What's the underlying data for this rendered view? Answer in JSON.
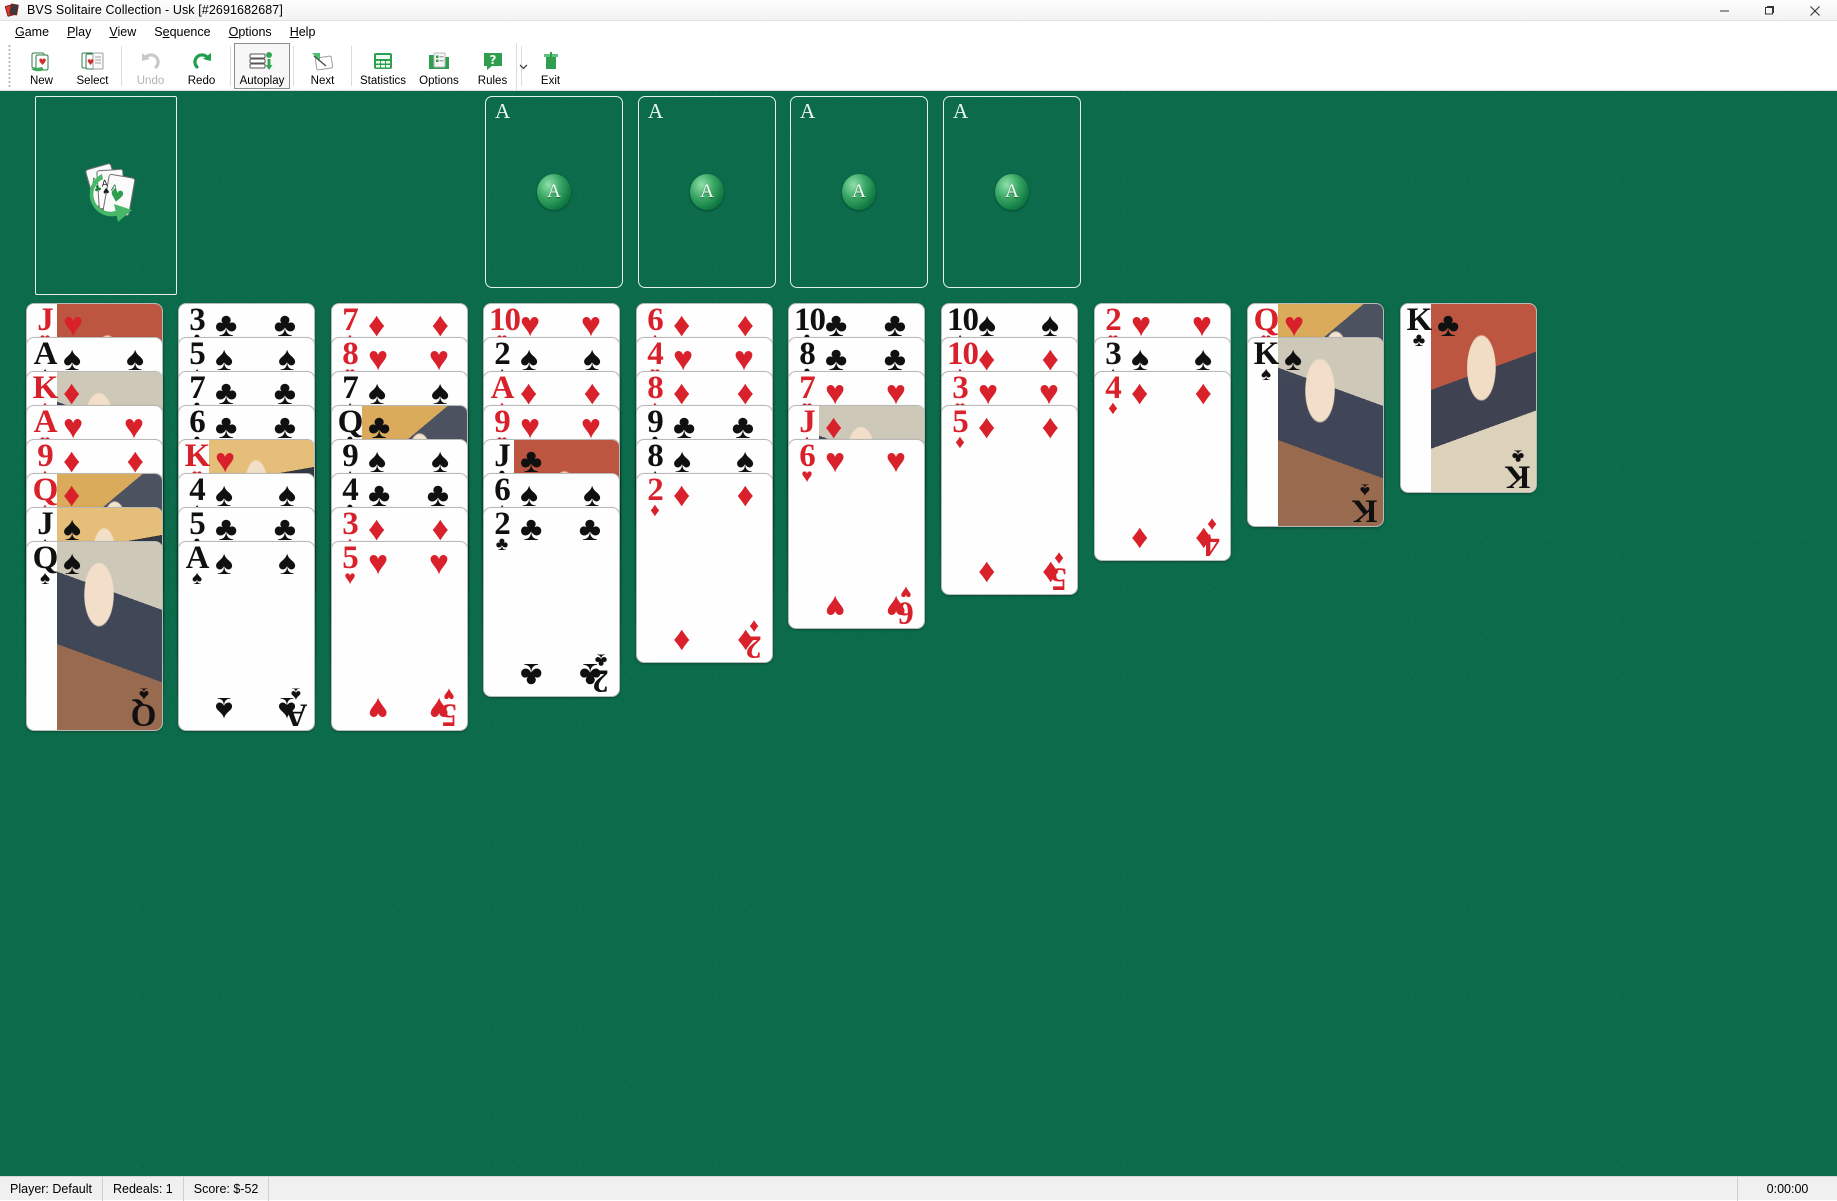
{
  "window": {
    "title": "BVS Solitaire Collection  -  Usk [#2691682687]",
    "icon": "cards-icon",
    "minimize": "minimize-icon",
    "maximize": "maximize-icon",
    "close": "close-icon"
  },
  "menu": {
    "items": [
      {
        "label": "Game",
        "accel": "G"
      },
      {
        "label": "Play",
        "accel": "P"
      },
      {
        "label": "View",
        "accel": "V"
      },
      {
        "label": "Sequence",
        "accel": "S"
      },
      {
        "label": "Options",
        "accel": "O"
      },
      {
        "label": "Help",
        "accel": "H"
      }
    ]
  },
  "toolbar": {
    "buttons": [
      {
        "label": "New",
        "icon": "new-game-icon",
        "enabled": true,
        "active": false
      },
      {
        "label": "Select",
        "icon": "select-game-icon",
        "enabled": true,
        "active": false
      },
      {
        "label": "Undo",
        "icon": "undo-icon",
        "enabled": false,
        "active": false
      },
      {
        "label": "Redo",
        "icon": "redo-icon",
        "enabled": true,
        "active": false
      },
      {
        "label": "Autoplay",
        "icon": "autoplay-icon",
        "enabled": true,
        "active": true
      },
      {
        "label": "Next",
        "icon": "next-icon",
        "enabled": true,
        "active": false
      },
      {
        "label": "Statistics",
        "icon": "statistics-icon",
        "enabled": true,
        "active": false
      },
      {
        "label": "Options",
        "icon": "options-icon",
        "enabled": true,
        "active": false
      },
      {
        "label": "Rules",
        "icon": "rules-icon",
        "enabled": true,
        "active": false
      },
      {
        "label": "Exit",
        "icon": "exit-icon",
        "enabled": true,
        "active": false
      }
    ],
    "overflow": "toolbar-overflow-icon"
  },
  "table": {
    "felt_color": "#0c6b4a",
    "stock": {
      "empty": true,
      "emblem": "stock-recycle-aces-icon"
    },
    "foundations": [
      {
        "corner_label": "A",
        "badge_label": "A",
        "empty": true
      },
      {
        "corner_label": "A",
        "badge_label": "A",
        "empty": true
      },
      {
        "corner_label": "A",
        "badge_label": "A",
        "empty": true
      },
      {
        "corner_label": "A",
        "badge_label": "A",
        "empty": true
      }
    ],
    "columns": [
      {
        "cards": [
          {
            "rank": "J",
            "suit": "hearts",
            "color": "red",
            "face": true,
            "art": "v1"
          },
          {
            "rank": "A",
            "suit": "spades",
            "color": "black",
            "face": false,
            "art": ""
          },
          {
            "rank": "K",
            "suit": "diamonds",
            "color": "red",
            "face": true,
            "art": "v2"
          },
          {
            "rank": "A",
            "suit": "hearts",
            "color": "red",
            "face": false,
            "art": ""
          },
          {
            "rank": "9",
            "suit": "diamonds",
            "color": "red",
            "face": false,
            "art": ""
          },
          {
            "rank": "Q",
            "suit": "diamonds",
            "color": "red",
            "face": true,
            "art": "v3"
          },
          {
            "rank": "J",
            "suit": "spades",
            "color": "black",
            "face": true,
            "art": "v4"
          },
          {
            "rank": "Q",
            "suit": "spades",
            "color": "black",
            "face": true,
            "art": "v2"
          }
        ]
      },
      {
        "cards": [
          {
            "rank": "3",
            "suit": "clubs",
            "color": "black",
            "face": false,
            "art": ""
          },
          {
            "rank": "5",
            "suit": "spades",
            "color": "black",
            "face": false,
            "art": ""
          },
          {
            "rank": "7",
            "suit": "clubs",
            "color": "black",
            "face": false,
            "art": ""
          },
          {
            "rank": "6",
            "suit": "clubs",
            "color": "black",
            "face": false,
            "art": ""
          },
          {
            "rank": "K",
            "suit": "hearts",
            "color": "red",
            "face": true,
            "art": "v4"
          },
          {
            "rank": "4",
            "suit": "spades",
            "color": "black",
            "face": false,
            "art": ""
          },
          {
            "rank": "5",
            "suit": "clubs",
            "color": "black",
            "face": false,
            "art": ""
          },
          {
            "rank": "A",
            "suit": "spades",
            "color": "black",
            "face": false,
            "art": ""
          }
        ]
      },
      {
        "cards": [
          {
            "rank": "7",
            "suit": "diamonds",
            "color": "red",
            "face": false,
            "art": ""
          },
          {
            "rank": "8",
            "suit": "hearts",
            "color": "red",
            "face": false,
            "art": ""
          },
          {
            "rank": "7",
            "suit": "spades",
            "color": "black",
            "face": false,
            "art": ""
          },
          {
            "rank": "Q",
            "suit": "clubs",
            "color": "black",
            "face": true,
            "art": "v3"
          },
          {
            "rank": "9",
            "suit": "spades",
            "color": "black",
            "face": false,
            "art": ""
          },
          {
            "rank": "4",
            "suit": "clubs",
            "color": "black",
            "face": false,
            "art": ""
          },
          {
            "rank": "3",
            "suit": "diamonds",
            "color": "red",
            "face": false,
            "art": ""
          },
          {
            "rank": "5",
            "suit": "hearts",
            "color": "red",
            "face": false,
            "art": ""
          }
        ]
      },
      {
        "cards": [
          {
            "rank": "10",
            "suit": "hearts",
            "color": "red",
            "face": false,
            "art": ""
          },
          {
            "rank": "2",
            "suit": "spades",
            "color": "black",
            "face": false,
            "art": ""
          },
          {
            "rank": "A",
            "suit": "diamonds",
            "color": "red",
            "face": false,
            "art": ""
          },
          {
            "rank": "9",
            "suit": "hearts",
            "color": "red",
            "face": false,
            "art": ""
          },
          {
            "rank": "J",
            "suit": "clubs",
            "color": "black",
            "face": true,
            "art": "v1"
          },
          {
            "rank": "6",
            "suit": "spades",
            "color": "black",
            "face": false,
            "art": ""
          },
          {
            "rank": "2",
            "suit": "clubs",
            "color": "black",
            "face": false,
            "art": ""
          }
        ]
      },
      {
        "cards": [
          {
            "rank": "6",
            "suit": "diamonds",
            "color": "red",
            "face": false,
            "art": ""
          },
          {
            "rank": "4",
            "suit": "hearts",
            "color": "red",
            "face": false,
            "art": ""
          },
          {
            "rank": "8",
            "suit": "diamonds",
            "color": "red",
            "face": false,
            "art": ""
          },
          {
            "rank": "9",
            "suit": "clubs",
            "color": "black",
            "face": false,
            "art": ""
          },
          {
            "rank": "8",
            "suit": "spades",
            "color": "black",
            "face": false,
            "art": ""
          },
          {
            "rank": "2",
            "suit": "diamonds",
            "color": "red",
            "face": false,
            "art": ""
          }
        ]
      },
      {
        "cards": [
          {
            "rank": "10",
            "suit": "clubs",
            "color": "black",
            "face": false,
            "art": ""
          },
          {
            "rank": "8",
            "suit": "clubs",
            "color": "black",
            "face": false,
            "art": ""
          },
          {
            "rank": "7",
            "suit": "hearts",
            "color": "red",
            "face": false,
            "art": ""
          },
          {
            "rank": "J",
            "suit": "diamonds",
            "color": "red",
            "face": true,
            "art": "v2"
          },
          {
            "rank": "6",
            "suit": "hearts",
            "color": "red",
            "face": false,
            "art": ""
          }
        ]
      },
      {
        "cards": [
          {
            "rank": "10",
            "suit": "spades",
            "color": "black",
            "face": false,
            "art": ""
          },
          {
            "rank": "10",
            "suit": "diamonds",
            "color": "red",
            "face": false,
            "art": ""
          },
          {
            "rank": "3",
            "suit": "hearts",
            "color": "red",
            "face": false,
            "art": ""
          },
          {
            "rank": "5",
            "suit": "diamonds",
            "color": "red",
            "face": false,
            "art": ""
          }
        ]
      },
      {
        "cards": [
          {
            "rank": "2",
            "suit": "hearts",
            "color": "red",
            "face": false,
            "art": ""
          },
          {
            "rank": "3",
            "suit": "spades",
            "color": "black",
            "face": false,
            "art": ""
          },
          {
            "rank": "4",
            "suit": "diamonds",
            "color": "red",
            "face": false,
            "art": ""
          }
        ]
      },
      {
        "cards": [
          {
            "rank": "Q",
            "suit": "hearts",
            "color": "red",
            "face": true,
            "art": "v3"
          },
          {
            "rank": "K",
            "suit": "spades",
            "color": "black",
            "face": true,
            "art": "v2"
          }
        ]
      },
      {
        "cards": [
          {
            "rank": "K",
            "suit": "clubs",
            "color": "black",
            "face": true,
            "art": "v1"
          }
        ]
      }
    ]
  },
  "status": {
    "player": "Player: Default",
    "redeals": "Redeals: 1",
    "score": "Score: $-52",
    "time": "0:00:00"
  },
  "suit_glyphs": {
    "hearts": "♥",
    "diamonds": "♦",
    "clubs": "♣",
    "spades": "♠"
  }
}
